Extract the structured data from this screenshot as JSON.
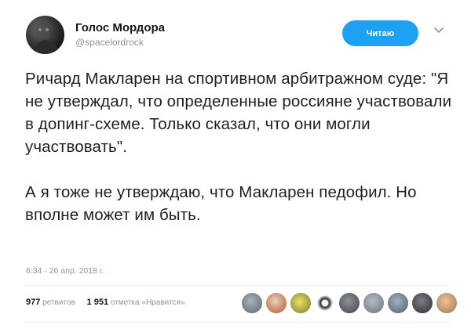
{
  "author": {
    "display_name": "Голос Мордора",
    "handle": "@spacelordrock",
    "avatar_icon": "dark-portrait-avatar"
  },
  "follow_button": {
    "label": "Читаю",
    "color": "#1da1f2"
  },
  "menu_icon": "chevron-down-icon",
  "tweet": {
    "paragraphs": [
      "Ричард Макларен на спортивном арбитражном суде: \"Я не утверждал, что определенные россияне участвовали в допинг-схеме. Только сказал, что они могли участвовать\".",
      "А я тоже не утверждаю, что Макларен педофил. Но вполне может им быть."
    ],
    "timestamp": "6:34 - 26 апр. 2018 г."
  },
  "stats": {
    "retweets_count": "977",
    "retweets_label": "ретвитов",
    "likes_count": "1 951",
    "likes_label": "отметка «Нравится»"
  },
  "likers": [
    "avatar-gray",
    "avatar-portrait",
    "avatar-emoji-face",
    "avatar-pattern",
    "avatar-dark",
    "avatar-gray",
    "avatar-gray",
    "avatar-group",
    "avatar-portrait-light"
  ]
}
